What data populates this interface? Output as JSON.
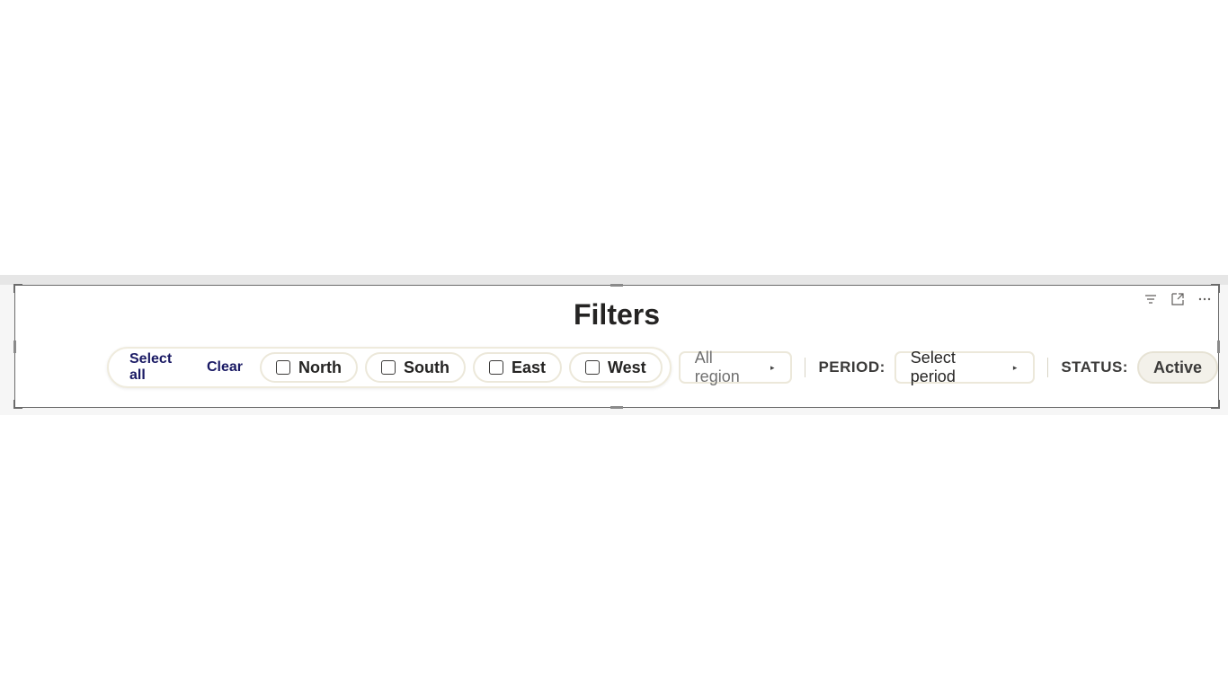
{
  "visual": {
    "title": "Filters",
    "header_icons": [
      "filter-icon",
      "focus-mode-icon",
      "more-options-icon"
    ]
  },
  "region": {
    "select_all_label": "Select all",
    "clear_label": "Clear",
    "options": [
      {
        "label": "North",
        "checked": false
      },
      {
        "label": "South",
        "checked": false
      },
      {
        "label": "East",
        "checked": false
      },
      {
        "label": "West",
        "checked": false
      }
    ],
    "dropdown_value": "All region"
  },
  "period": {
    "label": "PERIOD:",
    "dropdown_value": "Select period"
  },
  "status": {
    "label": "STATUS:",
    "value": "Active"
  },
  "colors": {
    "link": "#1a1a64",
    "chip_border": "#ece8da",
    "frame": "#6b6b6b"
  }
}
